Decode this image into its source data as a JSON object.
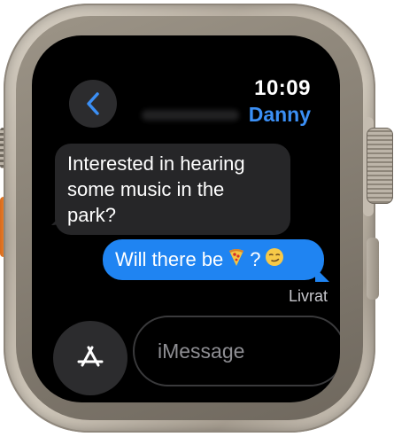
{
  "header": {
    "time": "10:09",
    "contact_name": "Danny"
  },
  "messages": [
    {
      "direction": "incoming",
      "text": "Interested in hearing some music in the park?"
    },
    {
      "direction": "outgoing",
      "text_before": "Will there be",
      "emoji_1": "pizza",
      "text_middle": "?",
      "emoji_2": "smirking-face"
    }
  ],
  "status": "Livrat",
  "composer": {
    "placeholder": "iMessage",
    "app_button_icon": "app-store-icon"
  },
  "colors": {
    "outgoing_bubble": "#1f84f2",
    "incoming_bubble": "#262628",
    "accent": "#3b8ff5",
    "action_button": "#e97a26"
  }
}
